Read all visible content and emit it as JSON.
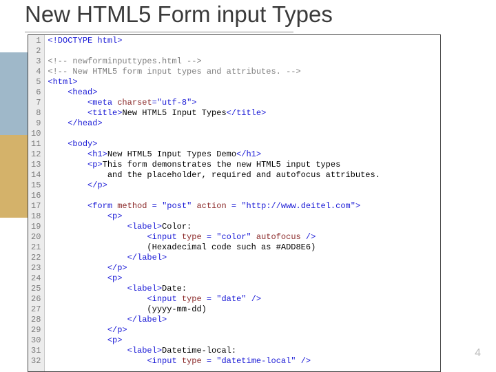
{
  "slide": {
    "title": "New HTML5 Form input Types",
    "page_number": "4"
  },
  "code": {
    "lines": [
      {
        "n": "1",
        "segs": [
          {
            "t": "<!DOCTYPE html>",
            "c": "t-blue"
          }
        ]
      },
      {
        "n": "2",
        "segs": []
      },
      {
        "n": "3",
        "segs": [
          {
            "t": "<!-- newforminputtypes.html -->",
            "c": "t-grey"
          }
        ]
      },
      {
        "n": "4",
        "segs": [
          {
            "t": "<!-- New HTML5 form input types and attributes. -->",
            "c": "t-grey"
          }
        ]
      },
      {
        "n": "5",
        "segs": [
          {
            "t": "<html>",
            "c": "t-blue"
          }
        ]
      },
      {
        "n": "6",
        "segs": [
          {
            "t": "    "
          },
          {
            "t": "<head>",
            "c": "t-blue"
          }
        ]
      },
      {
        "n": "7",
        "segs": [
          {
            "t": "        "
          },
          {
            "t": "<meta ",
            "c": "t-blue"
          },
          {
            "t": "charset",
            "c": "t-maroon"
          },
          {
            "t": "=",
            "c": "t-blue"
          },
          {
            "t": "\"utf-8\"",
            "c": "t-blue"
          },
          {
            "t": ">",
            "c": "t-blue"
          }
        ]
      },
      {
        "n": "8",
        "segs": [
          {
            "t": "        "
          },
          {
            "t": "<title>",
            "c": "t-blue"
          },
          {
            "t": "New HTML5 Input Types"
          },
          {
            "t": "</title>",
            "c": "t-blue"
          }
        ]
      },
      {
        "n": "9",
        "segs": [
          {
            "t": "    "
          },
          {
            "t": "</head>",
            "c": "t-blue"
          }
        ]
      },
      {
        "n": "10",
        "segs": []
      },
      {
        "n": "11",
        "segs": [
          {
            "t": "    "
          },
          {
            "t": "<body>",
            "c": "t-blue"
          }
        ]
      },
      {
        "n": "12",
        "segs": [
          {
            "t": "        "
          },
          {
            "t": "<h1>",
            "c": "t-blue"
          },
          {
            "t": "New HTML5 Input Types Demo"
          },
          {
            "t": "</h1>",
            "c": "t-blue"
          }
        ]
      },
      {
        "n": "13",
        "segs": [
          {
            "t": "        "
          },
          {
            "t": "<p>",
            "c": "t-blue"
          },
          {
            "t": "This form demonstrates the new HTML5 input types"
          }
        ]
      },
      {
        "n": "14",
        "segs": [
          {
            "t": "            and the placeholder, required and autofocus attributes."
          }
        ]
      },
      {
        "n": "15",
        "segs": [
          {
            "t": "        "
          },
          {
            "t": "</p>",
            "c": "t-blue"
          }
        ]
      },
      {
        "n": "16",
        "segs": []
      },
      {
        "n": "17",
        "segs": [
          {
            "t": "        "
          },
          {
            "t": "<form ",
            "c": "t-blue"
          },
          {
            "t": "method",
            "c": "t-maroon"
          },
          {
            "t": " = ",
            "c": "t-blue"
          },
          {
            "t": "\"post\"",
            "c": "t-blue"
          },
          {
            "t": " "
          },
          {
            "t": "action",
            "c": "t-maroon"
          },
          {
            "t": " = ",
            "c": "t-blue"
          },
          {
            "t": "\"http://www.deitel.com\"",
            "c": "t-blue"
          },
          {
            "t": ">",
            "c": "t-blue"
          }
        ]
      },
      {
        "n": "18",
        "segs": [
          {
            "t": "            "
          },
          {
            "t": "<p>",
            "c": "t-blue"
          }
        ]
      },
      {
        "n": "19",
        "segs": [
          {
            "t": "                "
          },
          {
            "t": "<label>",
            "c": "t-blue"
          },
          {
            "t": "Color:"
          }
        ]
      },
      {
        "n": "20",
        "segs": [
          {
            "t": "                    "
          },
          {
            "t": "<input ",
            "c": "t-blue"
          },
          {
            "t": "type",
            "c": "t-maroon"
          },
          {
            "t": " = ",
            "c": "t-blue"
          },
          {
            "t": "\"color\"",
            "c": "t-blue"
          },
          {
            "t": " "
          },
          {
            "t": "autofocus",
            "c": "t-maroon"
          },
          {
            "t": " />",
            "c": "t-blue"
          }
        ]
      },
      {
        "n": "21",
        "segs": [
          {
            "t": "                    (Hexadecimal code such as #ADD8E6)"
          }
        ]
      },
      {
        "n": "22",
        "segs": [
          {
            "t": "                "
          },
          {
            "t": "</label>",
            "c": "t-blue"
          }
        ]
      },
      {
        "n": "23",
        "segs": [
          {
            "t": "            "
          },
          {
            "t": "</p>",
            "c": "t-blue"
          }
        ]
      },
      {
        "n": "24",
        "segs": [
          {
            "t": "            "
          },
          {
            "t": "<p>",
            "c": "t-blue"
          }
        ]
      },
      {
        "n": "25",
        "segs": [
          {
            "t": "                "
          },
          {
            "t": "<label>",
            "c": "t-blue"
          },
          {
            "t": "Date:"
          }
        ]
      },
      {
        "n": "26",
        "segs": [
          {
            "t": "                    "
          },
          {
            "t": "<input ",
            "c": "t-blue"
          },
          {
            "t": "type",
            "c": "t-maroon"
          },
          {
            "t": " = ",
            "c": "t-blue"
          },
          {
            "t": "\"date\"",
            "c": "t-blue"
          },
          {
            "t": " />",
            "c": "t-blue"
          }
        ]
      },
      {
        "n": "27",
        "segs": [
          {
            "t": "                    (yyyy-mm-dd)"
          }
        ]
      },
      {
        "n": "28",
        "segs": [
          {
            "t": "                "
          },
          {
            "t": "</label>",
            "c": "t-blue"
          }
        ]
      },
      {
        "n": "29",
        "segs": [
          {
            "t": "            "
          },
          {
            "t": "</p>",
            "c": "t-blue"
          }
        ]
      },
      {
        "n": "30",
        "segs": [
          {
            "t": "            "
          },
          {
            "t": "<p>",
            "c": "t-blue"
          }
        ]
      },
      {
        "n": "31",
        "segs": [
          {
            "t": "                "
          },
          {
            "t": "<label>",
            "c": "t-blue"
          },
          {
            "t": "Datetime-local:"
          }
        ]
      },
      {
        "n": "32",
        "segs": [
          {
            "t": "                    "
          },
          {
            "t": "<input ",
            "c": "t-blue"
          },
          {
            "t": "type",
            "c": "t-maroon"
          },
          {
            "t": " = ",
            "c": "t-blue"
          },
          {
            "t": "\"datetime-local\"",
            "c": "t-blue"
          },
          {
            "t": " />",
            "c": "t-blue"
          }
        ]
      }
    ]
  }
}
